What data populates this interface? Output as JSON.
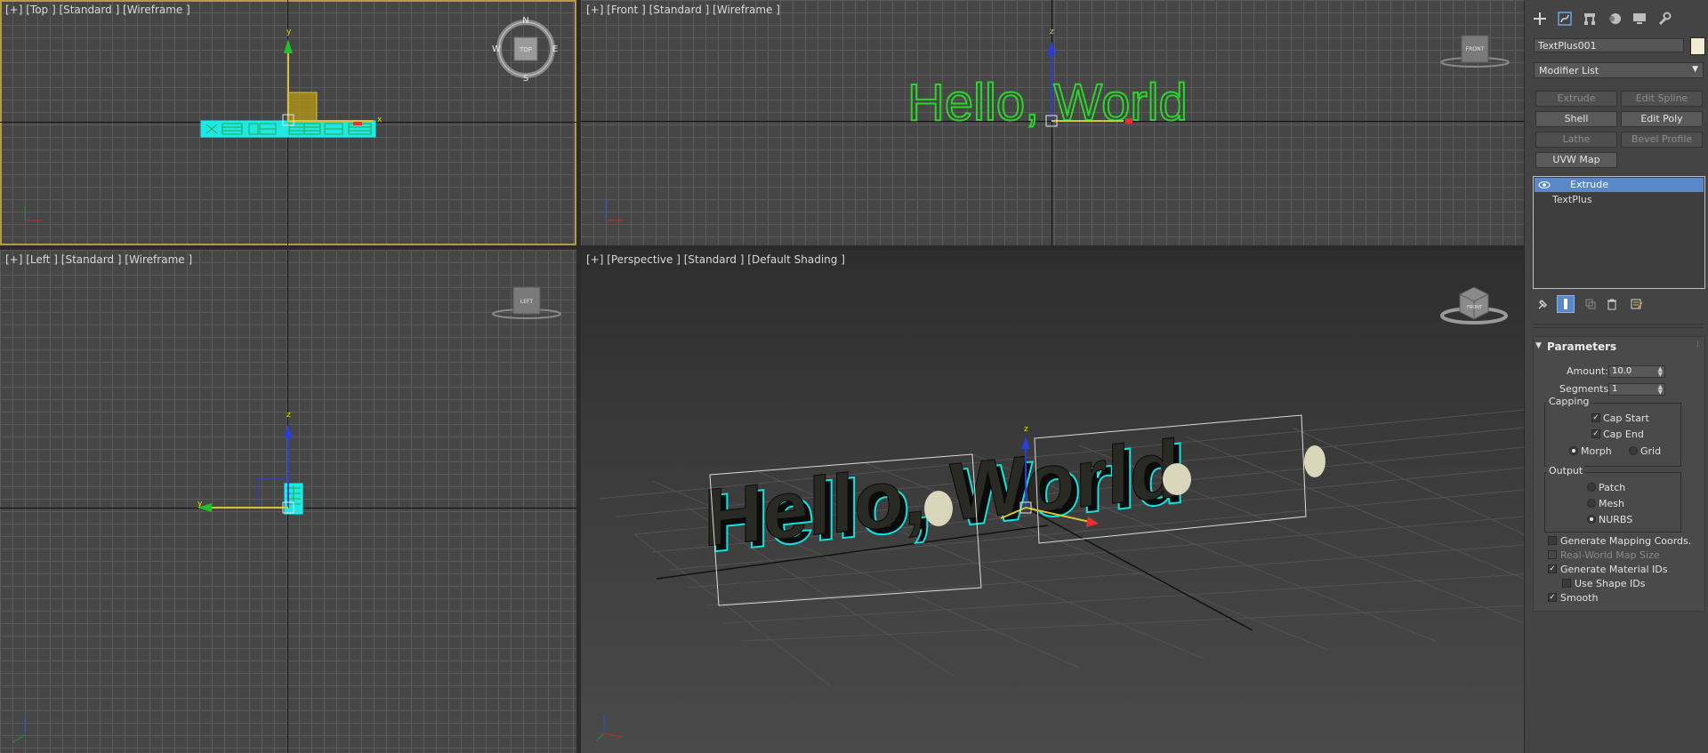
{
  "viewports": {
    "top": {
      "label": "[+] [Top ] [Standard ] [Wireframe ]",
      "compass": {
        "n": "N",
        "s": "S",
        "e": "E",
        "w": "W",
        "cube": "TOP"
      }
    },
    "front": {
      "label": "[+] [Front ] [Standard ] [Wireframe ]",
      "cube": "FRONT",
      "text": "Hello, World"
    },
    "left": {
      "label": "[+] [Left ] [Standard ] [Wireframe ]",
      "cube": "LEFT"
    },
    "perspective": {
      "label": "[+] [Perspective ] [Standard ] [Default Shading ]",
      "cube": "FRONT",
      "text": "Hello, World"
    },
    "axis_labels": {
      "x": "x",
      "y": "y",
      "z": "z"
    }
  },
  "panel": {
    "tabs": [
      {
        "icon": "create-icon"
      },
      {
        "icon": "modify-icon"
      },
      {
        "icon": "hierarchy-icon"
      },
      {
        "icon": "motion-icon"
      },
      {
        "icon": "display-icon"
      },
      {
        "icon": "utilities-icon"
      }
    ],
    "object_name": "TextPlus001",
    "object_color": "#f1ecd0",
    "modifier_list": "Modifier List",
    "modifier_buttons": {
      "extrude": "Extrude",
      "edit_spline": "Edit Spline",
      "shell": "Shell",
      "edit_poly": "Edit Poly",
      "lathe": "Lathe",
      "bevel_profile": "Bevel Profile",
      "uvw_map": "UVW Map"
    },
    "stack": {
      "item1": "Extrude",
      "item2": "TextPlus"
    },
    "parameters": {
      "title": "Parameters",
      "amount_label": "Amount:",
      "amount_value": "10.0",
      "segments_label": "Segments:",
      "segments_value": "1",
      "capping_label": "Capping",
      "cap_start": "Cap Start",
      "cap_end": "Cap End",
      "morph": "Morph",
      "grid": "Grid",
      "output_label": "Output",
      "patch": "Patch",
      "mesh": "Mesh",
      "nurbs": "NURBS",
      "gen_mapping": "Generate Mapping Coords.",
      "real_world": "Real-World Map Size",
      "gen_material_ids": "Generate Material IDs",
      "use_shape_ids": "Use Shape IDs",
      "smooth": "Smooth"
    }
  }
}
